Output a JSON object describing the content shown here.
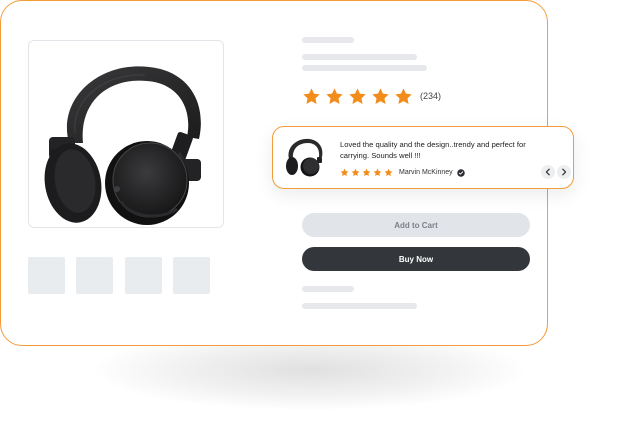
{
  "product": {
    "image_icon": "headphones-icon",
    "rating": {
      "stars": 5,
      "max_stars": 5,
      "count_label": "(234)"
    },
    "add_to_cart_label": "Add to Cart",
    "buy_now_label": "Buy Now",
    "thumbnail_count": 4
  },
  "review": {
    "text": "Loved the quality and the design..trendy and perfect for carrying. Sounds well !!!",
    "stars": 5,
    "reviewer": "Marvin McKinney",
    "verified_icon": "verified-check-icon",
    "prev_icon": "chevron-left-icon",
    "next_icon": "chevron-right-icon"
  },
  "colors": {
    "accent": "#f39c3a",
    "star": "#f28c1b",
    "skeleton": "#e6e8eb",
    "buy_button": "#33363b",
    "cart_button": "#e1e4e8"
  }
}
